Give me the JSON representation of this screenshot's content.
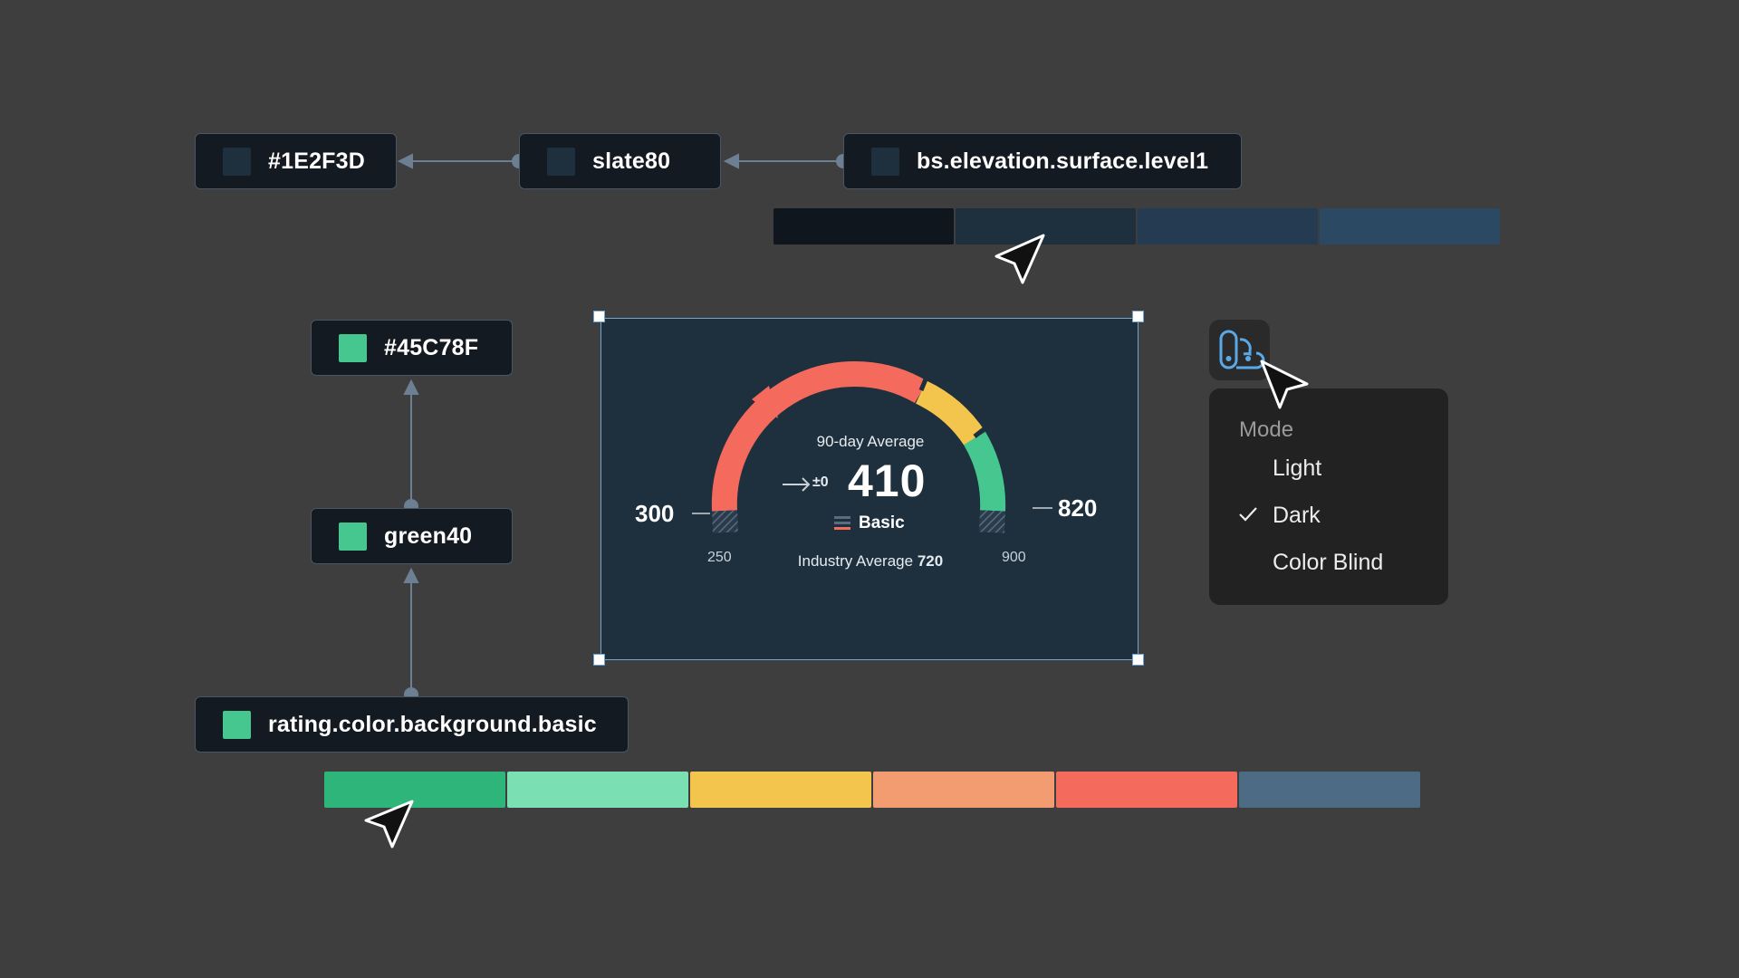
{
  "tokens": {
    "hex_dark": "#1E2F3D",
    "slate": "slate80",
    "elevation": "bs.elevation.surface.level1",
    "hex_green": "#45C78F",
    "green": "green40",
    "rating": "rating.color.background.basic"
  },
  "colors": {
    "surface": "#1E2F3D",
    "green": "#45C78F"
  },
  "gauge": {
    "label": "90-day Average",
    "change": "±0",
    "score": "410",
    "rating": "Basic",
    "industry_label": "Industry Average",
    "industry_value": "720",
    "min_label": "300",
    "max_label": "820",
    "low_tick": "250",
    "high_tick": "900"
  },
  "menu": {
    "title": "Mode",
    "items": [
      {
        "label": "Light",
        "selected": false
      },
      {
        "label": "Dark",
        "selected": true
      },
      {
        "label": "Color Blind",
        "selected": false
      }
    ]
  },
  "icons": [
    "arrow-right-icon",
    "theme-icon",
    "check-icon",
    "cursor-icon"
  ]
}
